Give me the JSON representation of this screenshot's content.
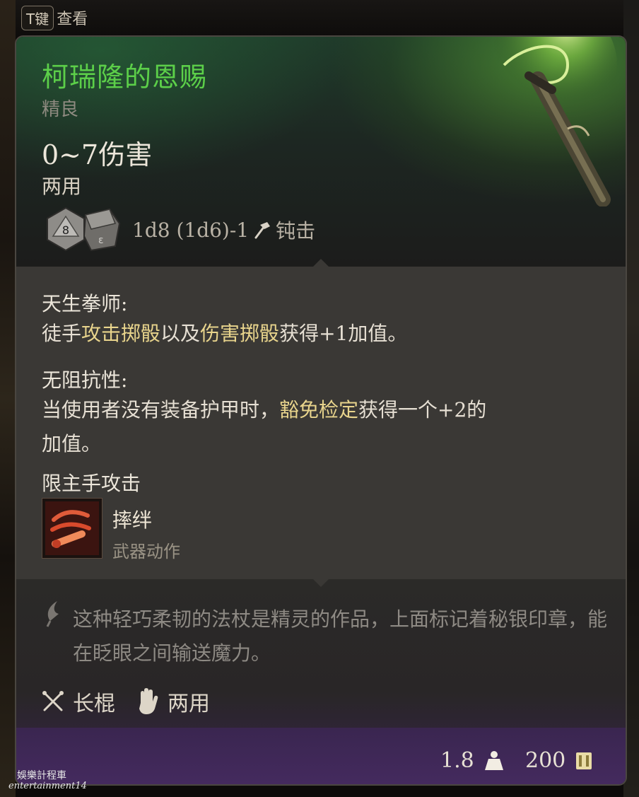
{
  "hint": {
    "key": "T键",
    "label": "查看"
  },
  "item": {
    "name": "柯瑞隆的恩赐",
    "rarity": "精良",
    "damage": "0~7伤害",
    "hands": "两用",
    "dice_formula": "1d8 (1d6)-1",
    "damage_type": "钝击",
    "die_main_face": "8"
  },
  "properties": [
    {
      "name": "天生拳师:",
      "line1_plain": "徒手",
      "line1_gold": "攻击掷骰",
      "line1_mid": "以及",
      "line1_gold2": "伤害掷骰",
      "line1_end": "获得+1加值。"
    },
    {
      "name": "无阻抗性:",
      "line1_plain": "当使用者没有装备护甲时，",
      "line1_gold": "豁免检定",
      "line1_end": "获得一个+2的",
      "line2": "加值。"
    }
  ],
  "restriction": "限主手攻击",
  "action": {
    "name": "摔绊",
    "type": "武器动作"
  },
  "flavor": "这种轻巧柔韧的法杖是精灵的作品，上面标记着秘银印章，能在眨眼之间输送魔力。",
  "tags": [
    {
      "icon": "crossed-staves-icon",
      "label": "长棍"
    },
    {
      "icon": "open-hand-icon",
      "label": "两用"
    }
  ],
  "footer": {
    "weight": "1.8",
    "value": "200"
  },
  "watermark": {
    "line1": "娛樂計程車",
    "line2": "entertainment14"
  },
  "colors": {
    "title": "#5ccf49",
    "gold_text": "#e8d48c",
    "footer_purple": "#442a5e"
  }
}
